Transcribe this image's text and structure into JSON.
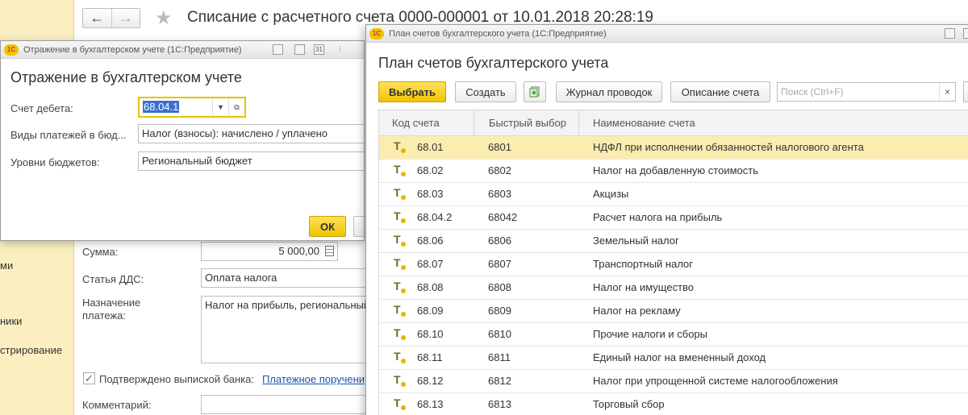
{
  "main": {
    "title": "Списание с расчетного счета 0000-000001 от 10.01.2018 20:28:19",
    "sections": [
      "ми",
      "ники",
      "стрирование"
    ],
    "fields": {
      "amount_label": "Сумма:",
      "amount_value": "5 000,00",
      "dds_label": "Статья ДДС:",
      "dds_value": "Оплата налога",
      "purpose_label_1": "Назначение",
      "purpose_label_2": "платежа:",
      "purpose_value": "Налог на прибыль, региональный",
      "confirmed_label": "Подтверждено выпиской банка:",
      "confirmed_link": "Платежное поручени",
      "comment_label": "Комментарий:"
    }
  },
  "dialog": {
    "window_title": "Отражение в бухгалтерском учете  (1С:Предприятие)",
    "heading": "Отражение в бухгалтерском учете",
    "debit_label": "Счет дебета:",
    "debit_value": "68.04.1",
    "payment_types_label": "Виды платежей в бюд...",
    "payment_types_value": "Налог (взносы): начислено / уплачено",
    "budget_levels_label": "Уровни бюджетов:",
    "budget_levels_value": "Региональный бюджет",
    "ok_label": "ОК"
  },
  "chart_of_accounts": {
    "window_title": "План счетов бухгалтерского учета  (1С:Предприятие)",
    "heading": "План счетов бухгалтерского учета",
    "buttons": {
      "select": "Выбрать",
      "create": "Создать",
      "journal": "Журнал проводок",
      "description": "Описание счета"
    },
    "search_placeholder": "Поиск (Ctrl+F)",
    "columns": [
      "Код счета",
      "Быстрый выбор",
      "Наименование счета"
    ],
    "rows": [
      {
        "code": "68.01",
        "quick": "6801",
        "name": "НДФЛ при исполнении обязанностей налогового агента"
      },
      {
        "code": "68.02",
        "quick": "6802",
        "name": "Налог на добавленную стоимость"
      },
      {
        "code": "68.03",
        "quick": "6803",
        "name": "Акцизы"
      },
      {
        "code": "68.04.2",
        "quick": "68042",
        "name": "Расчет налога на прибыль"
      },
      {
        "code": "68.06",
        "quick": "6806",
        "name": "Земельный налог"
      },
      {
        "code": "68.07",
        "quick": "6807",
        "name": "Транспортный налог"
      },
      {
        "code": "68.08",
        "quick": "6808",
        "name": "Налог на имущество"
      },
      {
        "code": "68.09",
        "quick": "6809",
        "name": "Налог на рекламу"
      },
      {
        "code": "68.10",
        "quick": "6810",
        "name": "Прочие налоги и сборы"
      },
      {
        "code": "68.11",
        "quick": "6811",
        "name": "Единый налог на вмененный доход"
      },
      {
        "code": "68.12",
        "quick": "6812",
        "name": "Налог при упрощенной системе налогообложения"
      },
      {
        "code": "68.13",
        "quick": "6813",
        "name": "Торговый сбор"
      }
    ],
    "selected_row": 0
  },
  "colors": {
    "accent": "#f0c400",
    "selected_row": "#fbedb0",
    "sidebar": "#fbeec0",
    "link": "#1a56a8"
  }
}
